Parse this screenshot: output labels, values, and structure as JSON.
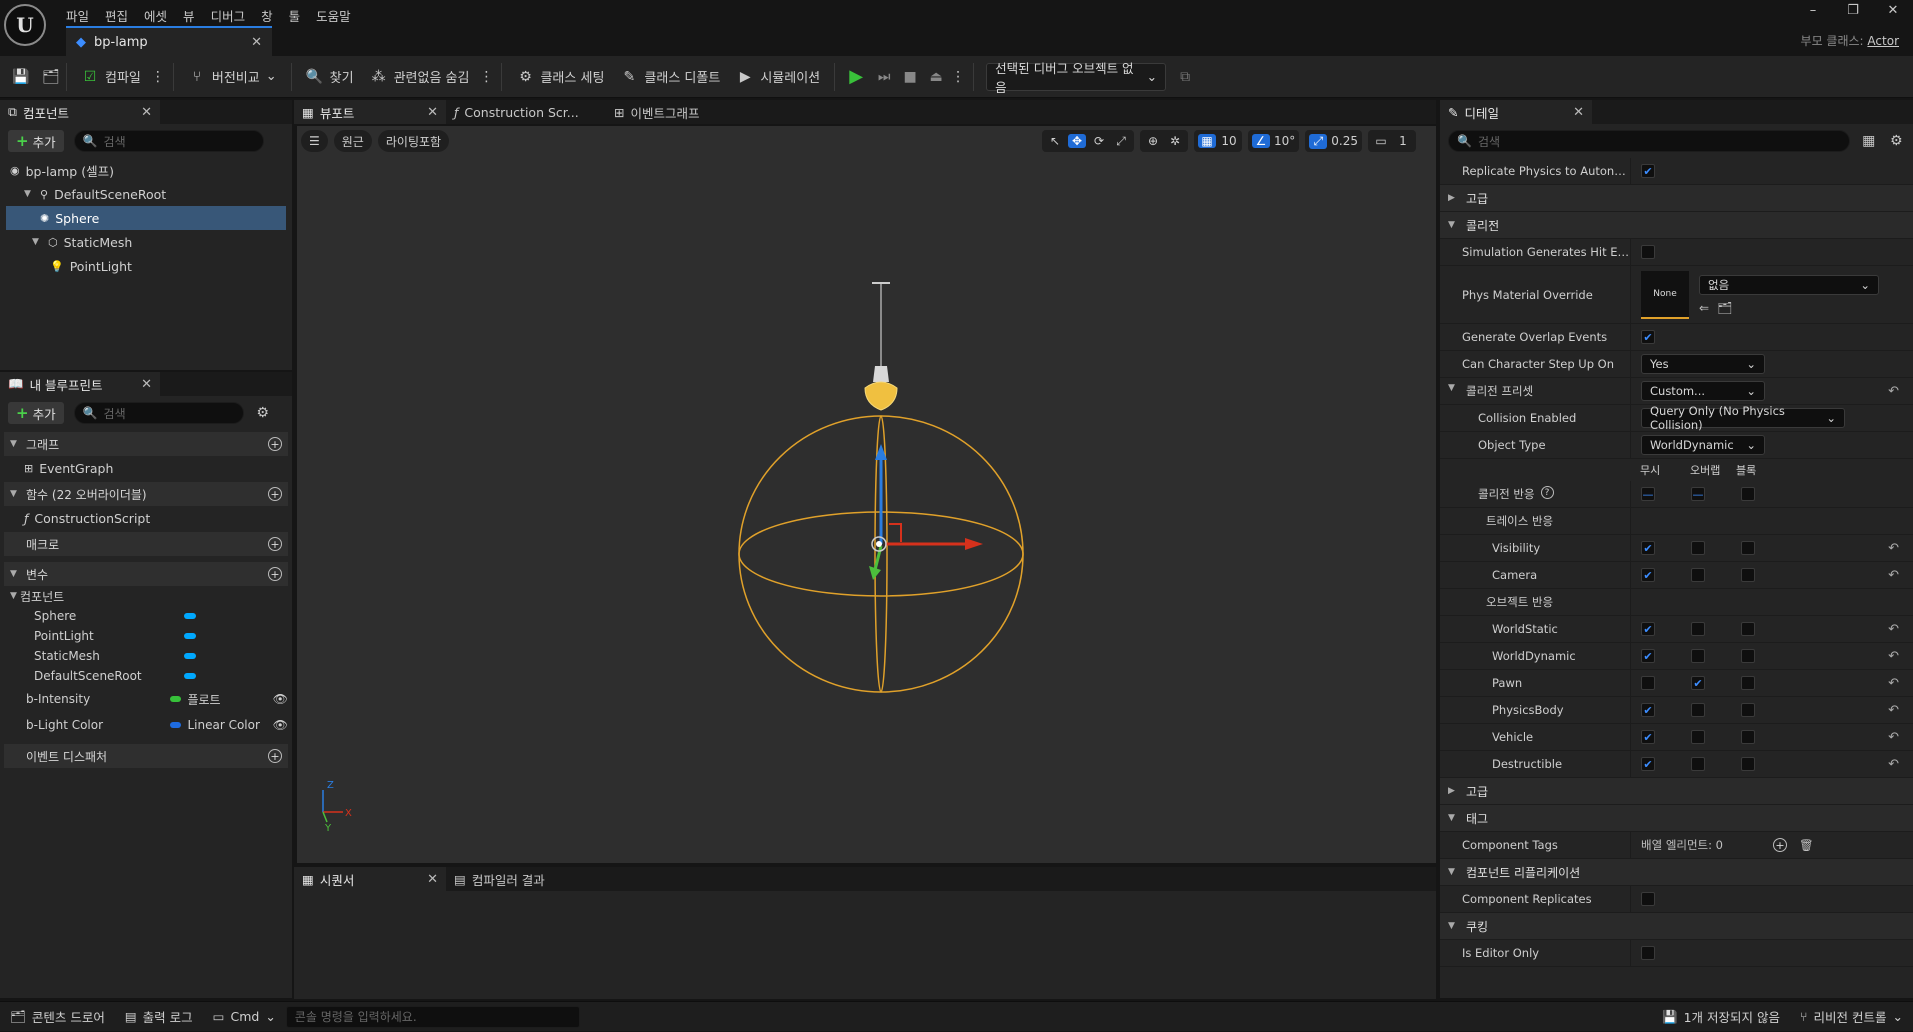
{
  "menu": [
    "파일",
    "편집",
    "에셋",
    "뷰",
    "디버그",
    "창",
    "툴",
    "도움말"
  ],
  "logo_text": "U",
  "doc_tab": {
    "title": "bp-lamp"
  },
  "window_controls": {
    "minimize": "–",
    "restore": "❐",
    "close": "✕"
  },
  "parent_class": {
    "label": "부모 클래스:",
    "value": "Actor"
  },
  "toolbar": {
    "compile": "컴파일",
    "diff": "버전비교",
    "find": "찾기",
    "hide_unrelated": "관련없음 숨김",
    "class_settings": "클래스 세팅",
    "class_defaults": "클래스 디폴트",
    "simulation": "시뮬레이션",
    "debug_select": "선택된 디버그 오브젝트 없음"
  },
  "components_panel": {
    "tab": "컴포넌트",
    "add": "추가",
    "search_placeholder": "검색",
    "tree": [
      {
        "label": "bp-lamp (셀프)",
        "icon": "actor-icon"
      },
      {
        "label": "DefaultSceneRoot",
        "icon": "scene-root-icon"
      },
      {
        "label": "Sphere",
        "icon": "sphere-icon"
      },
      {
        "label": "StaticMesh",
        "icon": "mesh-icon"
      },
      {
        "label": "PointLight",
        "icon": "bulb-icon"
      }
    ]
  },
  "blueprint_panel": {
    "tab": "내 블루프린트",
    "add": "추가",
    "search_placeholder": "검색",
    "graph": "그래프",
    "event_graph": "EventGraph",
    "functions": "함수 (22 오버라이더블)",
    "construction_script": "ConstructionScript",
    "macros": "매크로",
    "variables": "변수",
    "components_group": "컴포넌트",
    "component_vars": [
      "Sphere",
      "PointLight",
      "StaticMesh",
      "DefaultSceneRoot"
    ],
    "vars": [
      {
        "name": "b-Intensity",
        "type": "플로트",
        "color": "#37c13a"
      },
      {
        "name": "b-Light Color",
        "type": "Linear Color",
        "color": "#1e6be0"
      }
    ],
    "event_dispatchers": "이벤트 디스패처"
  },
  "center_tabs": {
    "viewport": "뷰포트",
    "construction": "Construction Scr...",
    "event_graph": "이벤트그래프"
  },
  "viewport": {
    "perspective": "원근",
    "lit": "라이팅포함",
    "grid_snap": "10",
    "rot_snap": "10°",
    "scale_snap": "0.25",
    "camera_speed": "1",
    "axis_x": "X",
    "axis_y": "Y",
    "axis_z": "Z"
  },
  "bottom_tabs": {
    "sequencer": "시퀀서",
    "compiler_results": "컴파일러 결과"
  },
  "details": {
    "tab": "디테일",
    "search_placeholder": "검색",
    "replicate_physics": "Replicate Physics to Autonom...",
    "advanced": "고급",
    "collision": "콜리전",
    "sim_hit_events": "Simulation Generates Hit Eve...",
    "phys_material": "Phys Material Override",
    "phys_none_thumb": "None",
    "phys_none": "없음",
    "gen_overlap": "Generate Overlap Events",
    "can_step_up": "Can Character Step Up On",
    "can_step_up_value": "Yes",
    "collision_presets": "콜리전 프리셋",
    "collision_presets_value": "Custom...",
    "collision_enabled": "Collision Enabled",
    "collision_enabled_value": "Query Only (No Physics Collision)",
    "object_type": "Object Type",
    "object_type_value": "WorldDynamic",
    "col_ignore": "무시",
    "col_overlap": "오버랩",
    "col_block": "블록",
    "collision_response": "콜리전 반응",
    "trace_response": "트레이스 반응",
    "object_response": "오브젝트 반응",
    "channels": [
      {
        "name": "Visibility",
        "state": "ignore",
        "reset": true
      },
      {
        "name": "Camera",
        "state": "ignore",
        "reset": true
      },
      {
        "name": "_obj",
        "state": "",
        "reset": false
      },
      {
        "name": "WorldStatic",
        "state": "ignore",
        "reset": true
      },
      {
        "name": "WorldDynamic",
        "state": "ignore",
        "reset": true
      },
      {
        "name": "Pawn",
        "state": "overlap",
        "reset": true
      },
      {
        "name": "PhysicsBody",
        "state": "ignore",
        "reset": true
      },
      {
        "name": "Vehicle",
        "state": "ignore",
        "reset": true
      },
      {
        "name": "Destructible",
        "state": "ignore",
        "reset": true
      }
    ],
    "advanced2": "고급",
    "tags": "태그",
    "component_tags": "Component Tags",
    "array_elements": "배열 엘리먼트: 0",
    "component_replication": "컴포넌트 리플리케이션",
    "component_replicates": "Component Replicates",
    "cooking": "쿠킹",
    "is_editor_only": "Is Editor Only"
  },
  "statusbar": {
    "content_drawer": "콘텐츠 드로어",
    "output_log": "출력 로그",
    "cmd": "Cmd",
    "console_placeholder": "콘솔 명령을 입력하세요.",
    "unsaved": "1개 저장되지 않음",
    "revision_control": "리비전 컨트롤"
  },
  "colors": {
    "accent": "#2a7de1",
    "selection": "#385778",
    "gizmo_orange": "#e0a12a",
    "play_green": "#39c03a"
  }
}
